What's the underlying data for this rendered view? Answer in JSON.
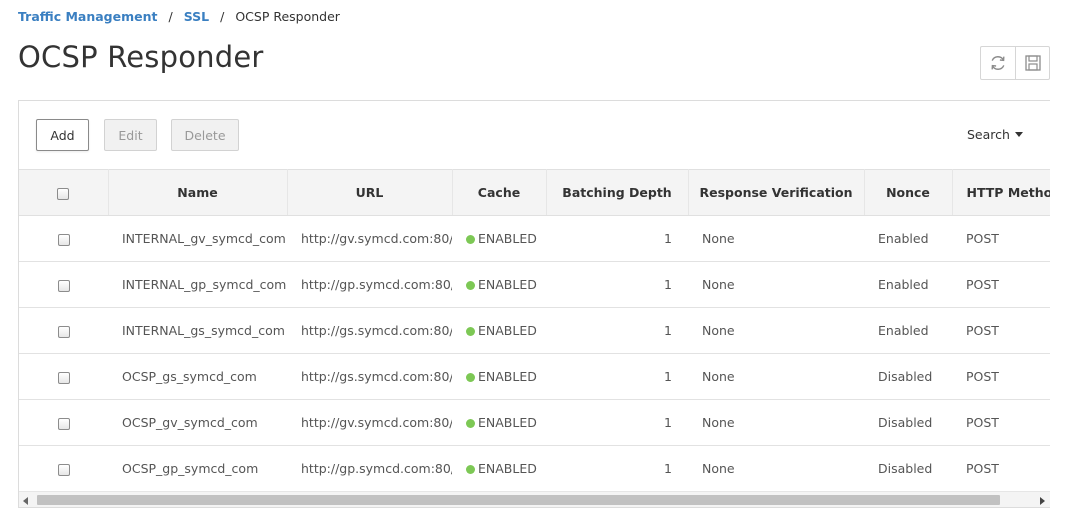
{
  "breadcrumb": {
    "items": [
      "Traffic Management",
      "SSL"
    ],
    "separator": "/",
    "current": "OCSP Responder"
  },
  "page": {
    "title": "OCSP Responder"
  },
  "header_tools": {
    "refresh_icon": "refresh-icon",
    "save_icon": "save-icon"
  },
  "toolbar": {
    "add": "Add",
    "edit": "Edit",
    "delete": "Delete",
    "search": "Search"
  },
  "table": {
    "columns": [
      "Name",
      "URL",
      "Cache",
      "Batching Depth",
      "Response Verification",
      "Nonce",
      "HTTP Method"
    ],
    "rows": [
      {
        "name": "INTERNAL_gv_symcd_com",
        "url": "http://gv.symcd.com:80/",
        "cache": "ENABLED",
        "batching_depth": "1",
        "response_verification": "None",
        "nonce": "Enabled",
        "http_method": "POST"
      },
      {
        "name": "INTERNAL_gp_symcd_com",
        "url": "http://gp.symcd.com:80/",
        "cache": "ENABLED",
        "batching_depth": "1",
        "response_verification": "None",
        "nonce": "Enabled",
        "http_method": "POST"
      },
      {
        "name": "INTERNAL_gs_symcd_com",
        "url": "http://gs.symcd.com:80/",
        "cache": "ENABLED",
        "batching_depth": "1",
        "response_verification": "None",
        "nonce": "Enabled",
        "http_method": "POST"
      },
      {
        "name": "OCSP_gs_symcd_com",
        "url": "http://gs.symcd.com:80/",
        "cache": "ENABLED",
        "batching_depth": "1",
        "response_verification": "None",
        "nonce": "Disabled",
        "http_method": "POST"
      },
      {
        "name": "OCSP_gv_symcd_com",
        "url": "http://gv.symcd.com:80/",
        "cache": "ENABLED",
        "batching_depth": "1",
        "response_verification": "None",
        "nonce": "Disabled",
        "http_method": "POST"
      },
      {
        "name": "OCSP_gp_symcd_com",
        "url": "http://gp.symcd.com:80/",
        "cache": "ENABLED",
        "batching_depth": "1",
        "response_verification": "None",
        "nonce": "Disabled",
        "http_method": "POST"
      }
    ]
  },
  "colors": {
    "link": "#3a7fc1",
    "status_enabled": "#7dc855",
    "header_bg": "#f4f4f4"
  }
}
